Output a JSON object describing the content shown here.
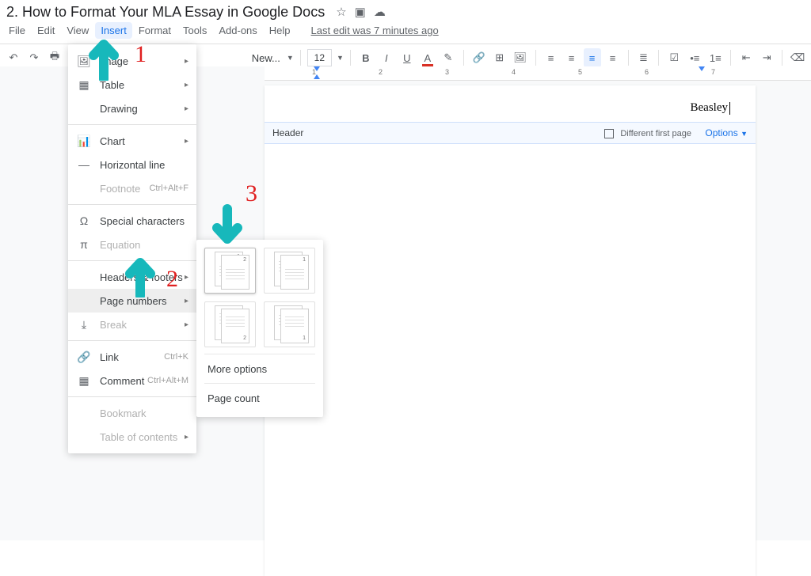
{
  "doc": {
    "title": "2. How to Format Your MLA Essay in Google Docs"
  },
  "menus": {
    "file": "File",
    "edit": "Edit",
    "view": "View",
    "insert": "Insert",
    "format": "Format",
    "tools": "Tools",
    "addons": "Add-ons",
    "help": "Help",
    "last_edit": "Last edit was 7 minutes ago"
  },
  "toolbar": {
    "font": "New...",
    "font_size": "12"
  },
  "insert_menu": {
    "image": "Image",
    "table": "Table",
    "drawing": "Drawing",
    "chart": "Chart",
    "hr": "Horizontal line",
    "footnote": "Footnote",
    "footnote_sc": "Ctrl+Alt+F",
    "special": "Special characters",
    "equation": "Equation",
    "headers": "Headers & footers",
    "page_numbers": "Page numbers",
    "break": "Break",
    "link": "Link",
    "link_sc": "Ctrl+K",
    "comment": "Comment",
    "comment_sc": "Ctrl+Alt+M",
    "bookmark": "Bookmark",
    "toc": "Table of contents"
  },
  "pn_submenu": {
    "more": "More options",
    "count": "Page count"
  },
  "header": {
    "label": "Header",
    "dfp": "Different first page",
    "options": "Options",
    "name": "Beasley"
  },
  "anno": {
    "one": "1",
    "two": "2",
    "three": "3"
  },
  "ruler": [
    "1",
    "2",
    "3",
    "4",
    "5",
    "6",
    "7"
  ]
}
